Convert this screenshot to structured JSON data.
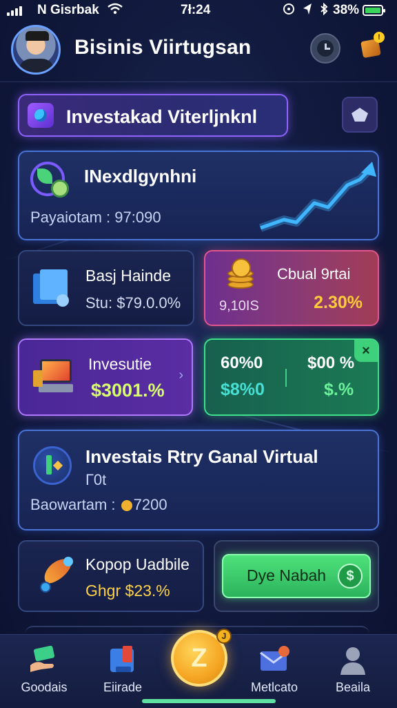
{
  "status_bar": {
    "carrier": "N Gisrbak",
    "time": "7ł:24",
    "battery_pct": "38%"
  },
  "header": {
    "title": "Bisinis Viirtugsan",
    "notif_badge": "!"
  },
  "banner": {
    "title": "Investakad Viterljnknl"
  },
  "investment_card": {
    "title": "INexdlgynhni",
    "value": "Payaiotam : 97:090"
  },
  "stat_cards": {
    "balance": {
      "title": "Basj Hainde",
      "subtitle": "Stu: $79.0.0%"
    },
    "dual": {
      "title": "Cbual 9rtai",
      "left": "9,10IS",
      "right": "2.30%"
    },
    "invest": {
      "title": "Invesutie",
      "value": "$3001.%",
      "chevron": "›"
    },
    "percent": {
      "top_left": "60%0",
      "top_right": "$00 %",
      "bottom_left": "$8%0",
      "bottom_right": "$.%"
    }
  },
  "virtual_card": {
    "title": "Investais Rtry Ganal Virtual",
    "subtitle": "Г0t",
    "value_prefix": "Baowartam : ",
    "value_suffix": "7200"
  },
  "kopor_card": {
    "title": "Kopор Uadbile",
    "value": "Ghgr $23.%"
  },
  "cta": {
    "label": "Dye Nabah",
    "icon_glyph": "$"
  },
  "bottom_nav": {
    "items": [
      {
        "label": "Goodais",
        "icon": "hand-money-icon"
      },
      {
        "label": "Eiirade",
        "icon": "wallet-icon"
      },
      {
        "label": "Metlcato",
        "icon": "envelope-icon"
      },
      {
        "label": "Beaila",
        "icon": "user-icon"
      }
    ],
    "center_glyph": "Z",
    "center_badge": "J"
  },
  "colors": {
    "accent_purple": "#8f63ff",
    "accent_green": "#3fe08a",
    "accent_pink": "#e2558e",
    "accent_gold": "#ffcb3a"
  }
}
